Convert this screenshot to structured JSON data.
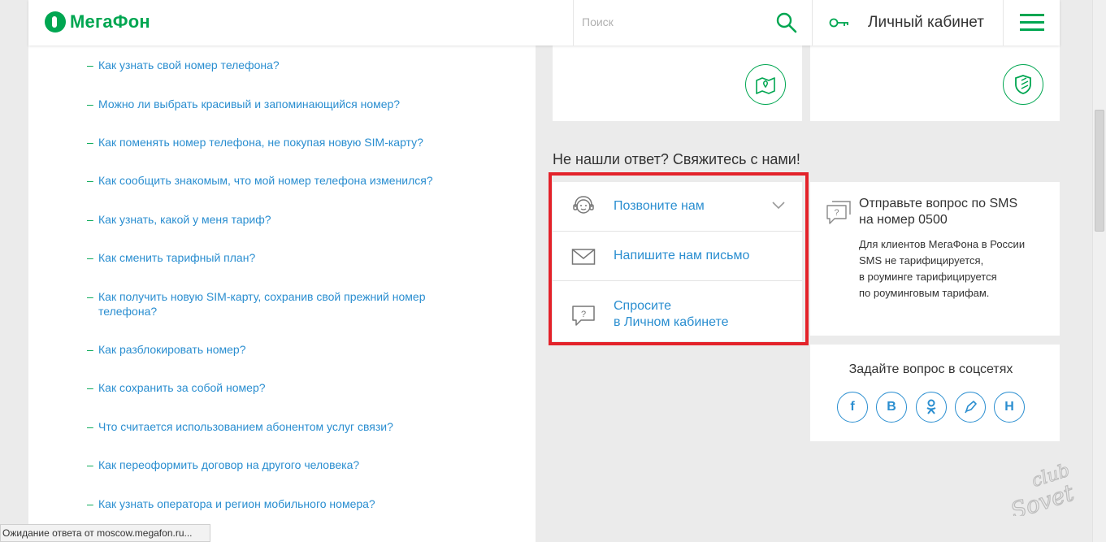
{
  "header": {
    "logo_text": "МегаФон",
    "search_placeholder": "Поиск",
    "cabinet_label": "Личный кабинет"
  },
  "faq": [
    "Как узнать свой номер телефона?",
    "Можно ли выбрать красивый и запоминающийся номер?",
    "Как поменять номер телефона, не покупая новую SIM-карту?",
    "Как сообщить знакомым, что мой номер телефона изменился?",
    "Как узнать, какой у меня тариф?",
    "Как сменить тарифный план?",
    "Как получить новую SIM-карту, сохранив свой прежний номер телефона?",
    "Как разблокировать номер?",
    "Как сохранить за собой номер?",
    "Что считается использованием абонентом услуг связи?",
    "Как переоформить договор на другого человека?",
    "Как узнать оператора и регион мобильного номера?"
  ],
  "faq_dash": "–",
  "contact": {
    "heading": "Не нашли ответ? Свяжитесь с нами!",
    "call": "Позвоните нам",
    "write": "Напишите нам письмо",
    "ask_line1": "Спросите",
    "ask_line2": "в Личном кабинете"
  },
  "sms": {
    "title_line1": "Отправьте вопрос по SMS",
    "title_line2": "на номер 0500",
    "text_line1": "Для клиентов МегаФона в России",
    "text_line2": "SMS не тарифицируется,",
    "text_line3": "в роуминге тарифицируется",
    "text_line4": "по роуминговым тарифам."
  },
  "social": {
    "title": "Задайте вопрос в соцсетях",
    "buttons": [
      "f",
      "B",
      "ok",
      "lj",
      "H"
    ]
  },
  "status_bar": "Ожидание ответа от moscow.megafon.ru...",
  "watermark": "club Sovet",
  "colors": {
    "brand_green": "#00a651",
    "link_blue": "#2a8ed0",
    "highlight_red": "#e3222a"
  }
}
